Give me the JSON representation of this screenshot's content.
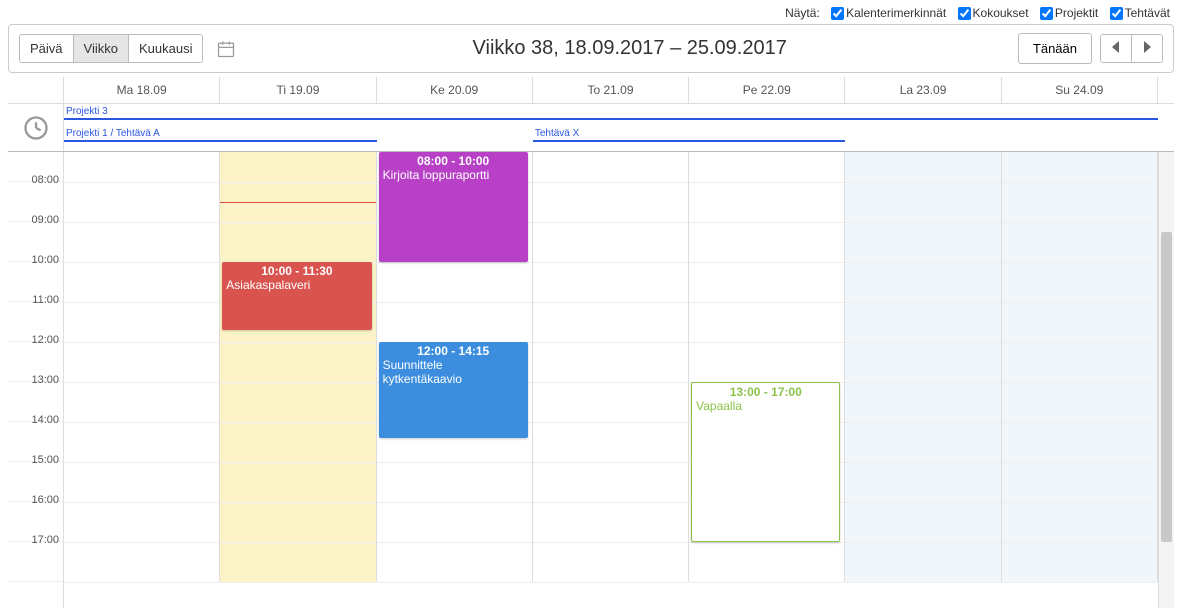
{
  "filterBar": {
    "label": "Näytä:",
    "options": [
      {
        "label": "Kalenterimerkinnät",
        "checked": true
      },
      {
        "label": "Kokoukset",
        "checked": true
      },
      {
        "label": "Projektit",
        "checked": true
      },
      {
        "label": "Tehtävät",
        "checked": true
      }
    ]
  },
  "views": {
    "day": "Päivä",
    "week": "Viikko",
    "month": "Kuukausi",
    "active": "week"
  },
  "rangeTitle": "Viikko 38, 18.09.2017 – 25.09.2017",
  "todayLabel": "Tänään",
  "days": [
    {
      "label": "Ma 18.09",
      "kind": "normal"
    },
    {
      "label": "Ti 19.09",
      "kind": "highlight"
    },
    {
      "label": "Ke 20.09",
      "kind": "normal"
    },
    {
      "label": "To 21.09",
      "kind": "normal"
    },
    {
      "label": "Pe 22.09",
      "kind": "normal"
    },
    {
      "label": "La 23.09",
      "kind": "weekend"
    },
    {
      "label": "Su 24.09",
      "kind": "weekend"
    }
  ],
  "hours": [
    "08:00",
    "09:00",
    "10:00",
    "11:00",
    "12:00",
    "13:00",
    "14:00",
    "15:00",
    "16:00",
    "17:00"
  ],
  "hourHeight": 40,
  "startHour": 7.25,
  "alldayBars": [
    {
      "label": "Projekti 3",
      "startDay": 0,
      "endDay": 7,
      "row": 0
    },
    {
      "label": "Projekti 1 / Tehtävä A",
      "startDay": 0,
      "endDay": 2,
      "row": 1
    },
    {
      "label": "Tehtävä X",
      "startDay": 3,
      "endDay": 5,
      "row": 1
    }
  ],
  "events": [
    {
      "timeLabel": "10:00 - 11:30",
      "title": "Asiakaspalaveri",
      "day": 1,
      "startHour": 10,
      "durationH": 1.7,
      "color": "#d9534f"
    },
    {
      "timeLabel": "08:00 - 10:00",
      "title": "Kirjoita loppuraportti",
      "day": 2,
      "startHour": 7.25,
      "durationH": 2.75,
      "color": "#b740c7"
    },
    {
      "timeLabel": "12:00 - 14:15",
      "title": "Suunnittele kytkentäkaavio",
      "day": 2,
      "startHour": 12,
      "durationH": 2.4,
      "color": "#3c8dde"
    },
    {
      "timeLabel": "13:00 - 17:00",
      "title": "Vapaalla",
      "day": 4,
      "startHour": 13,
      "durationH": 4,
      "borderOnly": true
    }
  ],
  "nowLine": {
    "day": 1,
    "hour": 8.5
  }
}
